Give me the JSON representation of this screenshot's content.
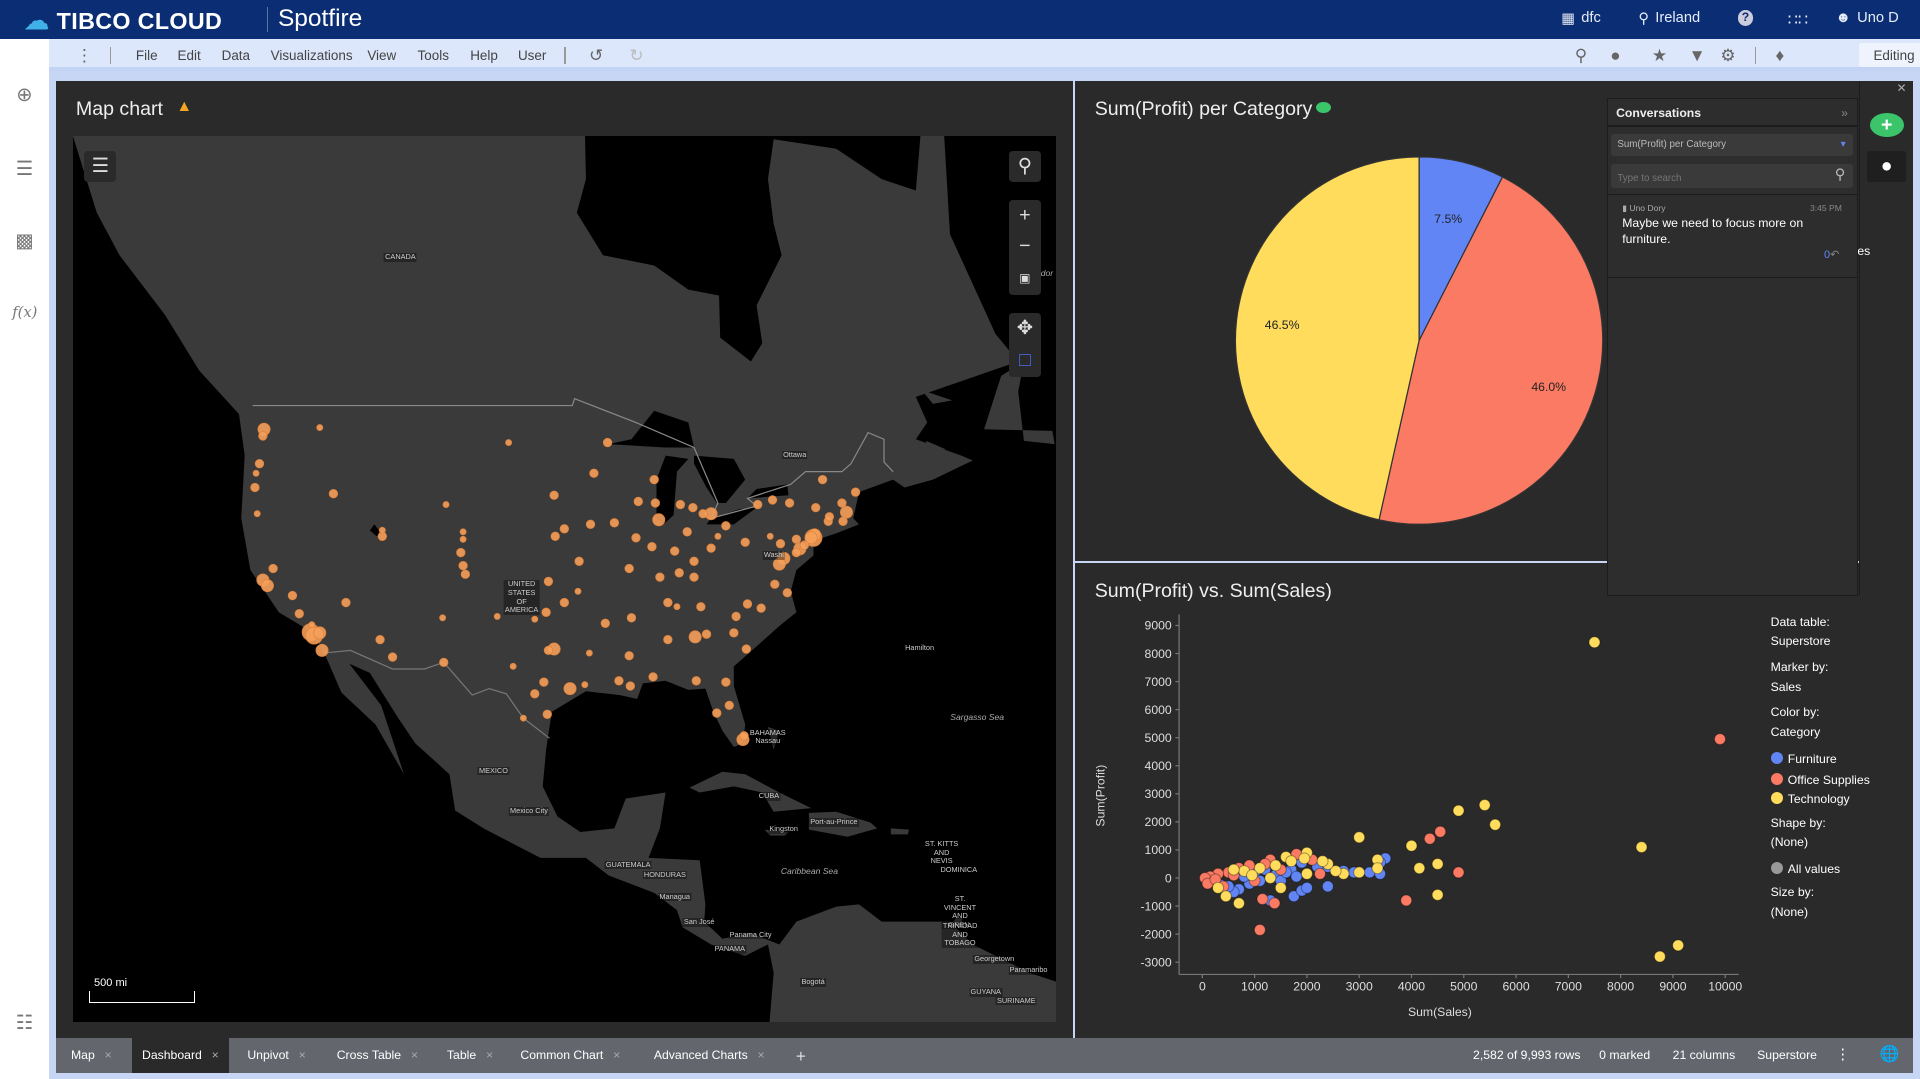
{
  "topbar": {
    "brand": "TIBCO CLOUD",
    "app": "Spotfire",
    "org": "dfc",
    "region": "Ireland",
    "user": "Uno D",
    "icons": [
      "org-icon",
      "location-pin-icon",
      "help-icon",
      "apps-grid-icon",
      "user-icon"
    ]
  },
  "menu": {
    "items": [
      "File",
      "Edit",
      "Data",
      "Visualizations",
      "View",
      "Tools",
      "Help",
      "User"
    ],
    "mode": "Editing"
  },
  "map": {
    "title": "Map chart",
    "scale": "500 mi",
    "labels": {
      "canada": "CANADA",
      "usa": "UNITED STATES OF AMERICA",
      "ottawa": "Ottawa",
      "washington": "Washi",
      "hamilton": "Hamilton",
      "sargasso": "Sargasso Sea",
      "bahamas": "BAHAMAS",
      "nassau": "Nassau",
      "mexico": "MEXICO",
      "mexico_city": "Mexico City",
      "cuba": "CUBA",
      "port_au_prince": "Port-au-Prince",
      "kingston": "Kingston",
      "guatemala": "GUATEMALA",
      "honduras": "HONDURAS",
      "caribbean": "Caribbean Sea",
      "managua": "Managua",
      "san_jose": "San José",
      "panama_city": "Panama City",
      "panama": "PANAMA",
      "st_kitts": "ST. KITTS AND NEVIS",
      "dominica": "DOMINICA",
      "st_vincent": "ST. VINCENT AND GREN.",
      "trinidad": "TRINIDAD AND TOBAGO",
      "georgetown": "Georgetown",
      "paramaribo": "Paramaribo",
      "guyana": "GUYANA",
      "suriname": "SURINAME",
      "bogota": "Bogotá",
      "labrador": "dor"
    },
    "marker_color": "#f5a05a",
    "points": [
      [
        -122.3,
        47.6,
        2
      ],
      [
        -122.4,
        47.2,
        1
      ],
      [
        -122.7,
        45.5,
        1
      ],
      [
        -123,
        44.9,
        0
      ],
      [
        -123.1,
        44,
        1
      ],
      [
        -122.9,
        42.3,
        0
      ],
      [
        -117.4,
        47.7,
        0
      ],
      [
        -116.2,
        43.6,
        1
      ],
      [
        -122.4,
        37.8,
        2
      ],
      [
        -122,
        37.4,
        2
      ],
      [
        -121.5,
        38.6,
        1
      ],
      [
        -119.8,
        36.7,
        1
      ],
      [
        -118.2,
        34.05,
        3
      ],
      [
        -117.9,
        33.8,
        3
      ],
      [
        -117.4,
        34,
        2
      ],
      [
        -117.2,
        32.7,
        2
      ],
      [
        -118.1,
        34.6,
        0
      ],
      [
        -119.2,
        35.4,
        1
      ],
      [
        -115.1,
        36.2,
        1
      ],
      [
        -112.1,
        33.5,
        1
      ],
      [
        -111,
        32.2,
        1
      ],
      [
        -106.6,
        35.1,
        0
      ],
      [
        -106.5,
        31.8,
        1
      ],
      [
        -111.9,
        40.8,
        1
      ],
      [
        -111.9,
        41.2,
        0
      ],
      [
        -105,
        39.7,
        1
      ],
      [
        -104.8,
        38.8,
        1
      ],
      [
        -104.8,
        40.6,
        0
      ],
      [
        -104.6,
        38.2,
        1
      ],
      [
        -101.8,
        35.2,
        0
      ],
      [
        -97.5,
        35.5,
        1
      ],
      [
        -95.9,
        36.2,
        1
      ],
      [
        -96.8,
        32.8,
        2
      ],
      [
        -97.3,
        32.7,
        1
      ],
      [
        -95.4,
        29.8,
        2
      ],
      [
        -98.5,
        29.4,
        1
      ],
      [
        -97.7,
        30.3,
        1
      ],
      [
        -94.1,
        30.1,
        0
      ],
      [
        -93.7,
        32.5,
        0
      ],
      [
        -92.3,
        34.7,
        1
      ],
      [
        -90.2,
        38.6,
        1
      ],
      [
        -94.6,
        39.1,
        1
      ],
      [
        -95.9,
        41.3,
        1
      ],
      [
        -96.7,
        40.8,
        1
      ],
      [
        -93.3,
        44.9,
        1
      ],
      [
        -92.1,
        46.8,
        1
      ],
      [
        -87.6,
        41.9,
        2
      ],
      [
        -87.9,
        43,
        1
      ],
      [
        -89.4,
        43.1,
        1
      ],
      [
        -88,
        44.5,
        1
      ],
      [
        -86.2,
        39.8,
        1
      ],
      [
        -85.1,
        41.1,
        1
      ],
      [
        -84.5,
        39.1,
        1
      ],
      [
        -83,
        40,
        1
      ],
      [
        -81.7,
        41.5,
        1
      ],
      [
        -83,
        42.3,
        2
      ],
      [
        -83.7,
        42.3,
        1
      ],
      [
        -85.7,
        42.9,
        1
      ],
      [
        -84.6,
        42.7,
        1
      ],
      [
        -80,
        40.4,
        1
      ],
      [
        -78.9,
        42.9,
        1
      ],
      [
        -77.6,
        43.2,
        1
      ],
      [
        -76.1,
        43,
        1
      ],
      [
        -73.8,
        42.7,
        1
      ],
      [
        -74,
        40.7,
        3
      ],
      [
        -73.9,
        40.9,
        2
      ],
      [
        -74.2,
        40.7,
        2
      ],
      [
        -75.2,
        39.95,
        2
      ],
      [
        -76.6,
        39.3,
        2
      ],
      [
        -77,
        38.9,
        2
      ],
      [
        -77.4,
        37.5,
        1
      ],
      [
        -76.3,
        36.9,
        1
      ],
      [
        -78.6,
        35.8,
        1
      ],
      [
        -80.8,
        35.2,
        1
      ],
      [
        -79.8,
        36.1,
        1
      ],
      [
        -81,
        34,
        1
      ],
      [
        -79.9,
        32.8,
        1
      ],
      [
        -84.4,
        33.7,
        2
      ],
      [
        -83.4,
        33.9,
        1
      ],
      [
        -81.7,
        30.3,
        1
      ],
      [
        -81.4,
        28.5,
        1
      ],
      [
        -82.5,
        27.9,
        1
      ],
      [
        -80.2,
        25.8,
        2
      ],
      [
        -80.1,
        26.1,
        1
      ],
      [
        -84.3,
        30.4,
        1
      ],
      [
        -86.8,
        33.5,
        1
      ],
      [
        -88.1,
        30.7,
        1
      ],
      [
        -90.1,
        30,
        1
      ],
      [
        -91.1,
        30.4,
        1
      ],
      [
        -90.2,
        32.3,
        1
      ],
      [
        -86.8,
        36.2,
        1
      ],
      [
        -85.8,
        38.3,
        1
      ],
      [
        -84.5,
        38,
        1
      ],
      [
        -83.9,
        35.9,
        1
      ],
      [
        -90,
        35.1,
        1
      ],
      [
        -71.1,
        42.4,
        2
      ],
      [
        -71.4,
        41.8,
        1
      ],
      [
        -72.7,
        41.8,
        1
      ],
      [
        -72.6,
        42.1,
        1
      ],
      [
        -70.3,
        43.7,
        1
      ],
      [
        -71.5,
        43,
        1
      ],
      [
        -73.2,
        44.5,
        1
      ],
      [
        -75.5,
        39.7,
        1
      ],
      [
        -74.8,
        40.2,
        1
      ],
      [
        -75.5,
        40.6,
        1
      ],
      [
        -76.9,
        40.3,
        1
      ],
      [
        -77.8,
        40.8,
        0
      ],
      [
        -82.4,
        40.8,
        0
      ],
      [
        -86,
        35.9,
        0
      ],
      [
        -94.7,
        37,
        0
      ],
      [
        -97.3,
        37.7,
        1
      ],
      [
        -98.5,
        35,
        0
      ],
      [
        -100.4,
        31.5,
        0
      ],
      [
        -99.5,
        27.5,
        0
      ],
      [
        -97.4,
        27.8,
        1
      ],
      [
        -106.3,
        42.9,
        0
      ],
      [
        -104.8,
        41.1,
        0
      ],
      [
        -96.8,
        43.5,
        1
      ],
      [
        -100.8,
        46.8,
        0
      ],
      [
        -93.6,
        41.6,
        1
      ],
      [
        -91.5,
        41.7,
        1
      ],
      [
        -89.6,
        40.7,
        1
      ],
      [
        -88.2,
        40.1,
        1
      ],
      [
        -87.5,
        38,
        1
      ]
    ]
  },
  "pie": {
    "title": "Sum(Profit) per Category",
    "chart_data": {
      "type": "pie",
      "categories": [
        "Furniture",
        "Office Supplies",
        "Technology"
      ],
      "values": [
        7.5,
        46.0,
        46.5
      ],
      "labels": [
        "7.5%",
        "46.0%",
        "46.5%"
      ],
      "colors": [
        "#6185f5",
        "#fb7a63",
        "#ffdc5c"
      ]
    }
  },
  "scatter": {
    "title": "Sum(Profit) vs. Sum(Sales)",
    "chart_data": {
      "type": "scatter",
      "xlabel": "Sum(Sales)",
      "ylabel": "Sum(Profit)",
      "xlim": [
        0,
        10000
      ],
      "ylim": [
        -3000,
        9000
      ],
      "xticks": [
        "0",
        "1000",
        "2000",
        "3000",
        "4000",
        "5000",
        "6000",
        "7000",
        "8000",
        "9000",
        "10000"
      ],
      "yticks": [
        "9000",
        "8000",
        "7000",
        "6000",
        "5000",
        "4000",
        "3000",
        "2000",
        "1000",
        "0",
        "-1000",
        "-2000",
        "-3000"
      ],
      "series": [
        {
          "name": "Furniture",
          "color": "#6185f5",
          "points": [
            [
              3500,
              700
            ],
            [
              3400,
              550
            ],
            [
              3200,
              200
            ],
            [
              3400,
              150
            ],
            [
              2900,
              200
            ],
            [
              2700,
              250
            ],
            [
              2400,
              400
            ],
            [
              1700,
              300
            ],
            [
              1800,
              50
            ],
            [
              1300,
              -800
            ],
            [
              1750,
              -650
            ],
            [
              1900,
              -450
            ],
            [
              2000,
              -350
            ],
            [
              2400,
              -300
            ],
            [
              1200,
              300
            ],
            [
              1000,
              200
            ],
            [
              900,
              -200
            ],
            [
              700,
              -400
            ],
            [
              600,
              -500
            ],
            [
              500,
              -300
            ],
            [
              350,
              -250
            ],
            [
              200,
              -100
            ],
            [
              1400,
              100
            ],
            [
              1500,
              -100
            ],
            [
              1600,
              200
            ],
            [
              800,
              50
            ],
            [
              1100,
              -100
            ],
            [
              2200,
              400
            ],
            [
              1900,
              550
            ]
          ]
        },
        {
          "name": "Office Supplies",
          "color": "#fb7a63",
          "points": [
            [
              9900,
              4950
            ],
            [
              4550,
              1650
            ],
            [
              4350,
              1400
            ],
            [
              4900,
              200
            ],
            [
              3900,
              -800
            ],
            [
              1100,
              -1850
            ],
            [
              1380,
              -900
            ],
            [
              1150,
              -750
            ],
            [
              2250,
              150
            ],
            [
              1800,
              850
            ],
            [
              2100,
              650
            ],
            [
              1300,
              650
            ],
            [
              900,
              450
            ],
            [
              700,
              350
            ],
            [
              500,
              200
            ],
            [
              300,
              150
            ],
            [
              150,
              50
            ],
            [
              50,
              0
            ],
            [
              100,
              -200
            ],
            [
              400,
              -300
            ],
            [
              1000,
              -100
            ],
            [
              1500,
              300
            ],
            [
              600,
              100
            ],
            [
              250,
              -50
            ],
            [
              1200,
              500
            ]
          ]
        },
        {
          "name": "Technology",
          "color": "#ffdc5c",
          "points": [
            [
              7500,
              8400
            ],
            [
              5400,
              2600
            ],
            [
              4900,
              2400
            ],
            [
              5600,
              1900
            ],
            [
              3000,
              1450
            ],
            [
              4000,
              1150
            ],
            [
              8400,
              1100
            ],
            [
              4150,
              350
            ],
            [
              4500,
              500
            ],
            [
              4500,
              -600
            ],
            [
              8750,
              -2800
            ],
            [
              9100,
              -2400
            ],
            [
              700,
              -900
            ],
            [
              450,
              -650
            ],
            [
              1500,
              -350
            ],
            [
              3350,
              650
            ],
            [
              3350,
              350
            ],
            [
              3000,
              200
            ],
            [
              2700,
              150
            ],
            [
              2550,
              250
            ],
            [
              2400,
              500
            ],
            [
              2300,
              600
            ],
            [
              2000,
              900
            ],
            [
              1600,
              750
            ],
            [
              1950,
              700
            ],
            [
              2000,
              150
            ],
            [
              1400,
              450
            ],
            [
              1100,
              350
            ],
            [
              800,
              250
            ],
            [
              600,
              300
            ],
            [
              300,
              -350
            ],
            [
              1700,
              600
            ],
            [
              1300,
              0
            ],
            [
              950,
              100
            ]
          ]
        }
      ]
    },
    "legend": {
      "data_table_label": "Data table:",
      "data_table": "Superstore",
      "marker_label": "Marker by:",
      "marker": "Sales",
      "color_label": "Color by:",
      "color": "Category",
      "items": [
        "Furniture",
        "Office Supplies",
        "Technology"
      ],
      "shape_label": "Shape by:",
      "shape": "(None)",
      "all_values": "All values",
      "size_label": "Size by:",
      "size": "(None)"
    }
  },
  "conversations": {
    "title": "Conversations",
    "filter": "Sum(Profit) per Category",
    "search_placeholder": "Type to search",
    "comment": {
      "author": "Uno Dory",
      "time": "3:45 PM",
      "text": "Maybe we need to focus more on furniture.",
      "replies": "0"
    },
    "peek_text": "es"
  },
  "tabs": {
    "items": [
      "Map",
      "Dashboard",
      "Unpivot",
      "Cross Table",
      "Table",
      "Common Chart",
      "Advanced Charts"
    ],
    "active": "Dashboard"
  },
  "status": {
    "rows": "2,582 of 9,993 rows",
    "marked": "0 marked",
    "columns": "21 columns",
    "table": "Superstore"
  }
}
